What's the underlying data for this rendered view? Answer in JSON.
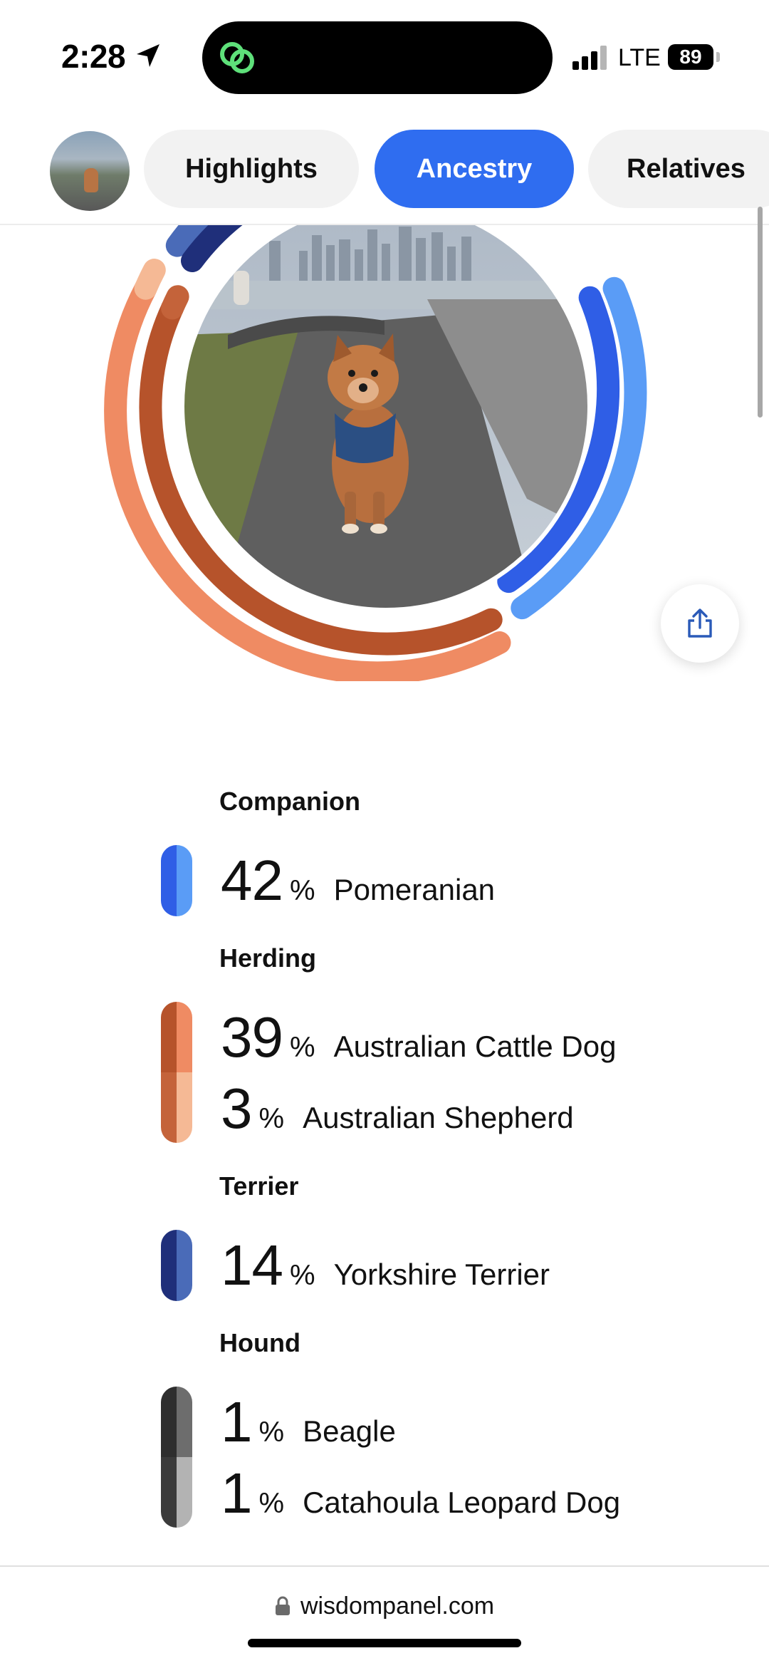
{
  "status_bar": {
    "time": "2:28",
    "network": "LTE",
    "battery": "89",
    "location_icon": "location-arrow-icon",
    "island_app_icon": "wisdom-app-icon"
  },
  "tabs": [
    {
      "label": "Highlights",
      "active": false
    },
    {
      "label": "Ancestry",
      "active": true
    },
    {
      "label": "Relatives",
      "active": false
    }
  ],
  "share_icon": "share-icon",
  "breakdown": [
    {
      "group": "Companion",
      "breeds": [
        {
          "percent": "42",
          "name": "Pomeranian",
          "colors": [
            "#2f5ee6",
            "#5a9cf6"
          ]
        }
      ]
    },
    {
      "group": "Herding",
      "breeds": [
        {
          "percent": "39",
          "name": "Australian Cattle Dog",
          "colors": [
            "#b6532b",
            "#ef8b63"
          ]
        },
        {
          "percent": "3",
          "name": "Australian Shepherd",
          "colors": [
            "#c4633a",
            "#f5b995"
          ]
        }
      ]
    },
    {
      "group": "Terrier",
      "breeds": [
        {
          "percent": "14",
          "name": "Yorkshire Terrier",
          "colors": [
            "#1f2f7a",
            "#4a6bb8"
          ]
        }
      ]
    },
    {
      "group": "Hound",
      "breeds": [
        {
          "percent": "1",
          "name": "Beagle",
          "colors": [
            "#2e2e2e",
            "#6d6d6d"
          ]
        },
        {
          "percent": "1",
          "name": "Catahoula Leopard Dog",
          "colors": [
            "#3b3b3b",
            "#b3b3b3"
          ]
        }
      ]
    }
  ],
  "percent_symbol": "%",
  "browser": {
    "url": "wisdompanel.com"
  }
}
